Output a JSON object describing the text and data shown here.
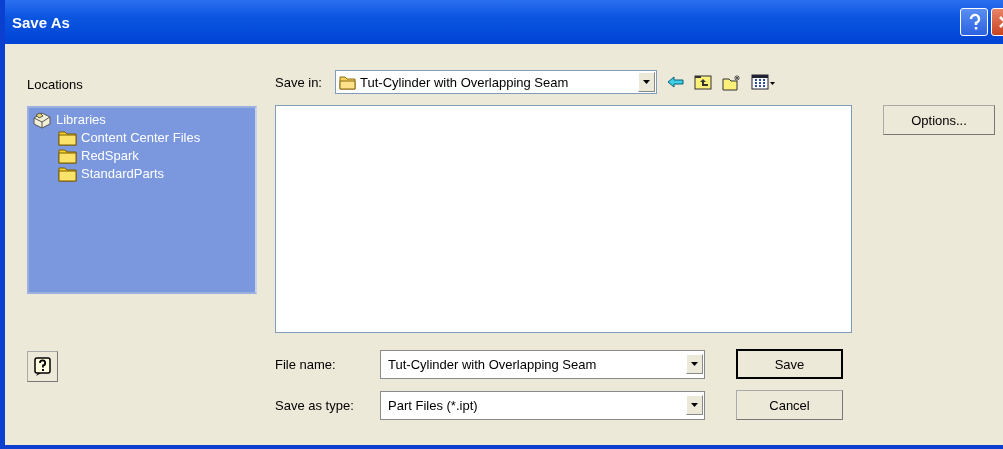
{
  "window": {
    "title": "Save As"
  },
  "locations": {
    "label": "Locations",
    "items": [
      {
        "label": "Libraries",
        "kind": "library",
        "children": [
          {
            "label": "Content Center Files",
            "kind": "folder"
          },
          {
            "label": "RedSpark",
            "kind": "folder"
          },
          {
            "label": "StandardParts",
            "kind": "folder"
          }
        ]
      }
    ]
  },
  "save_in": {
    "label": "Save in:",
    "value": "Tut-Cylinder with Overlapping Seam"
  },
  "options_button": {
    "label": "Options...",
    "default": false
  },
  "form": [
    {
      "label": "File name:",
      "value": "Tut-Cylinder with Overlapping Seam"
    },
    {
      "label": "Save as type:",
      "value": "Part Files (*.ipt)"
    }
  ],
  "buttons": [
    {
      "label": "Save",
      "default": true
    },
    {
      "label": "Cancel",
      "default": false
    }
  ]
}
